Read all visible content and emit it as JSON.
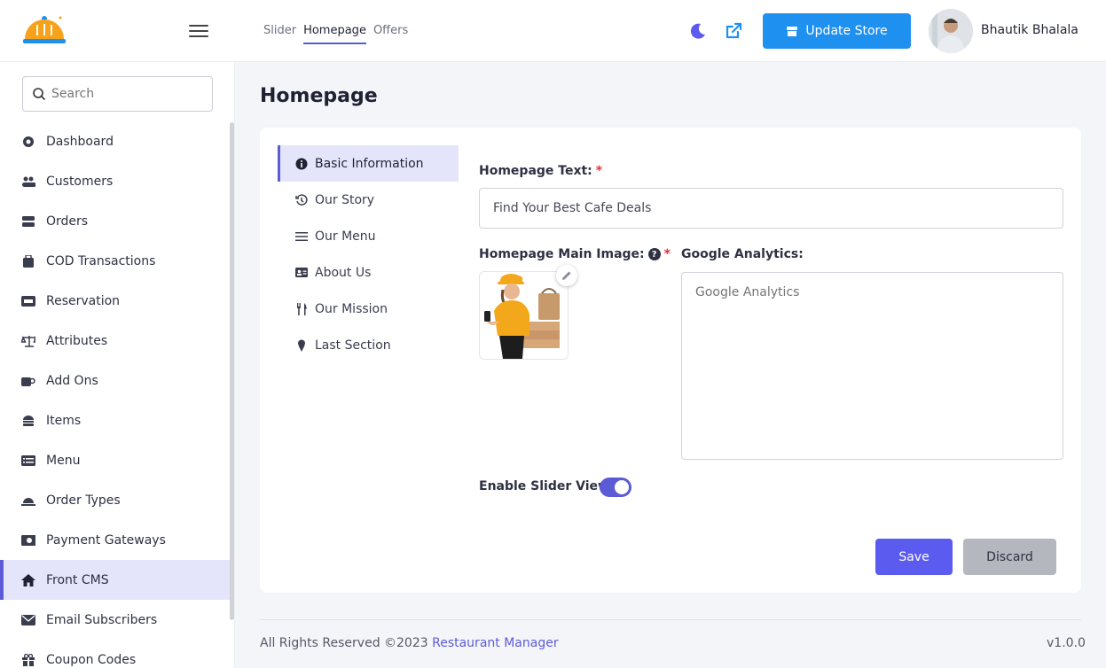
{
  "header": {
    "tabs": [
      {
        "label": "Slider"
      },
      {
        "label": "Homepage"
      },
      {
        "label": "Offers"
      }
    ],
    "update_store_label": "Update Store",
    "user_name": "Bhautik Bhalala"
  },
  "sidebar": {
    "search_placeholder": "Search",
    "items": [
      {
        "label": "Dashboard",
        "icon": "dashboard-icon"
      },
      {
        "label": "Customers",
        "icon": "users-icon"
      },
      {
        "label": "Orders",
        "icon": "orders-icon"
      },
      {
        "label": "COD Transactions",
        "icon": "wallet-icon"
      },
      {
        "label": "Reservation",
        "icon": "ticket-icon"
      },
      {
        "label": "Attributes",
        "icon": "scale-icon"
      },
      {
        "label": "Add Ons",
        "icon": "cup-icon"
      },
      {
        "label": "Items",
        "icon": "burger-icon"
      },
      {
        "label": "Menu",
        "icon": "list-icon"
      },
      {
        "label": "Order Types",
        "icon": "cloche-icon"
      },
      {
        "label": "Payment Gateways",
        "icon": "money-icon"
      },
      {
        "label": "Front CMS",
        "icon": "home-icon"
      },
      {
        "label": "Email Subscribers",
        "icon": "mail-icon"
      },
      {
        "label": "Coupon Codes",
        "icon": "gift-icon"
      }
    ]
  },
  "main": {
    "page_title": "Homepage",
    "subnav": [
      {
        "label": "Basic Information",
        "icon": "info-icon"
      },
      {
        "label": "Our Story",
        "icon": "history-icon"
      },
      {
        "label": "Our Menu",
        "icon": "menu-lines-icon"
      },
      {
        "label": "About Us",
        "icon": "id-card-icon"
      },
      {
        "label": "Our Mission",
        "icon": "utensils-icon"
      },
      {
        "label": "Last Section",
        "icon": "ice-cream-icon"
      }
    ],
    "homepage_text_label": "Homepage Text:",
    "homepage_text_value": "Find Your Best Cafe Deals",
    "main_image_label": "Homepage Main Image:",
    "google_analytics_label": "Google Analytics:",
    "google_analytics_placeholder": "Google Analytics",
    "slider_label": "Enable Slider View:",
    "required_mark": "*",
    "help_mark": "?",
    "save_label": "Save",
    "discard_label": "Discard"
  },
  "footer": {
    "copyright": "All Rights Reserved ©2023",
    "brand_link": "Restaurant Manager",
    "version": "v1.0.0"
  },
  "colors": {
    "accent": "#5b5bd6",
    "primary_button": "#1e90f0",
    "logo_orange": "#f7a21b"
  }
}
